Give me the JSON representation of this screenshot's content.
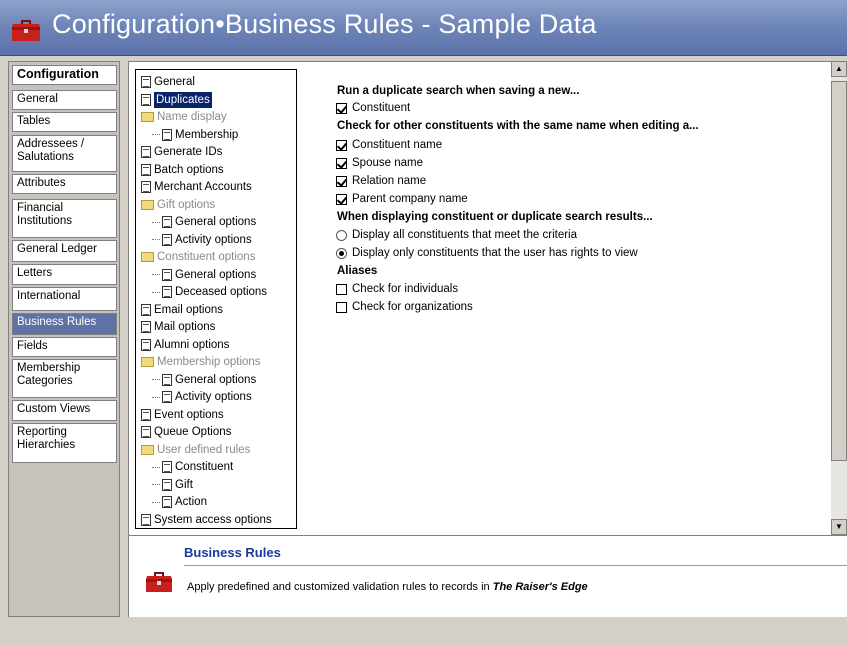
{
  "header": {
    "title": "Configuration•Business Rules - Sample Data",
    "icon": "toolbox-icon"
  },
  "nav": [
    {
      "label": "Configuration",
      "head": true
    },
    {
      "label": "General"
    },
    {
      "label": "Tables"
    },
    {
      "label": "Addressees / Salutations"
    },
    {
      "label": "Attributes"
    },
    {
      "label": "Financial Institutions"
    },
    {
      "label": "General Ledger"
    },
    {
      "label": "Letters"
    },
    {
      "label": "International"
    },
    {
      "label": "Business Rules",
      "selected": true
    },
    {
      "label": "Fields"
    },
    {
      "label": "Membership Categories"
    },
    {
      "label": "Custom Views"
    },
    {
      "label": "Reporting Hierarchies"
    }
  ],
  "tree": [
    {
      "label": "General"
    },
    {
      "label": "Duplicates",
      "selected": true
    },
    {
      "label": "Name display",
      "folder": true
    },
    {
      "label": "Membership",
      "child": true
    },
    {
      "label": "Generate IDs"
    },
    {
      "label": "Batch options"
    },
    {
      "label": "Merchant Accounts"
    },
    {
      "label": "Gift options",
      "folder": true
    },
    {
      "label": "General options",
      "child": true
    },
    {
      "label": "Activity options",
      "child": true
    },
    {
      "label": "Constituent options",
      "folder": true
    },
    {
      "label": "General options",
      "child": true
    },
    {
      "label": "Deceased options",
      "child": true
    },
    {
      "label": "Email options"
    },
    {
      "label": "Mail options"
    },
    {
      "label": "Alumni options"
    },
    {
      "label": "Membership options",
      "folder": true
    },
    {
      "label": "General options",
      "child": true
    },
    {
      "label": "Activity options",
      "child": true
    },
    {
      "label": "Event options"
    },
    {
      "label": "Queue Options"
    },
    {
      "label": "User defined rules",
      "folder": true
    },
    {
      "label": "Constituent",
      "child": true
    },
    {
      "label": "Gift",
      "child": true
    },
    {
      "label": "Action",
      "child": true
    },
    {
      "label": "System access options"
    }
  ],
  "content": {
    "h1": "Run a duplicate search when saving a new...",
    "c1": {
      "label": "Constituent",
      "checked": true
    },
    "h2": "Check for other constituents with the same name when editing a...",
    "c2": {
      "label": "Constituent name",
      "checked": true
    },
    "c3": {
      "label": "Spouse name",
      "checked": true
    },
    "c4": {
      "label": "Relation name",
      "checked": true
    },
    "c5": {
      "label": "Parent company name",
      "checked": true
    },
    "h3": "When displaying constituent or duplicate search results...",
    "r1": {
      "label": "Display all constituents that meet the criteria",
      "checked": false
    },
    "r2": {
      "label": "Display only constituents that the user has rights to view",
      "checked": true
    },
    "h4": "Aliases",
    "c6": {
      "label": "Check for individuals",
      "checked": false
    },
    "c7": {
      "label": "Check for organizations",
      "checked": false
    }
  },
  "desc": {
    "title": "Business Rules",
    "text_before": "Apply predefined and customized validation rules to records in ",
    "text_em": "The Raiser's Edge"
  }
}
